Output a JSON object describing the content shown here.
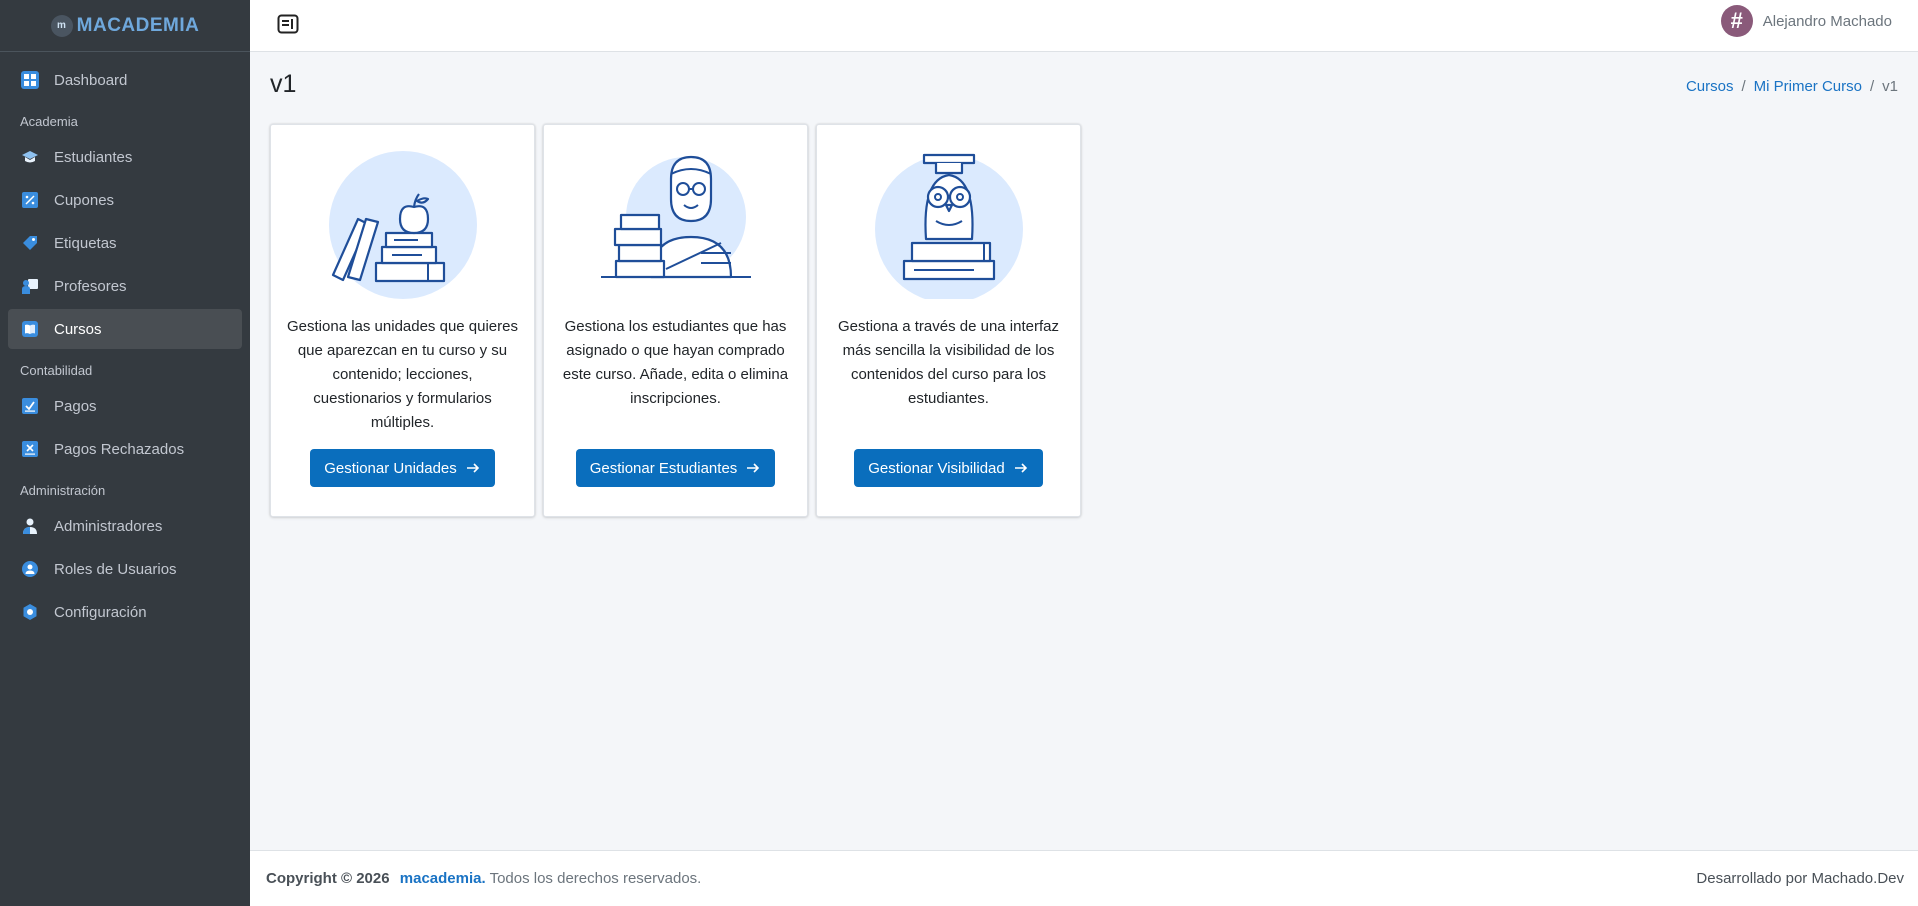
{
  "brand": {
    "name": "MACADEMIA",
    "mark_text": "m"
  },
  "sidebar": {
    "items": [
      {
        "label": "Dashboard",
        "icon": "dashboard-icon"
      },
      {
        "header": "Academia"
      },
      {
        "label": "Estudiantes",
        "icon": "graduation-cap-icon"
      },
      {
        "label": "Cupones",
        "icon": "coupon-icon"
      },
      {
        "label": "Etiquetas",
        "icon": "tag-icon"
      },
      {
        "label": "Profesores",
        "icon": "teacher-icon"
      },
      {
        "label": "Cursos",
        "icon": "book-open-icon",
        "active": true
      },
      {
        "header": "Contabilidad"
      },
      {
        "label": "Pagos",
        "icon": "payment-check-icon"
      },
      {
        "label": "Pagos Rechazados",
        "icon": "payment-rejected-icon"
      },
      {
        "header": "Administración"
      },
      {
        "label": "Administradores",
        "icon": "user-icon"
      },
      {
        "label": "Roles de Usuarios",
        "icon": "user-role-icon"
      },
      {
        "label": "Configuración",
        "icon": "settings-icon"
      }
    ]
  },
  "topbar": {
    "user_name": "Alejandro Machado",
    "avatar_symbol": "#"
  },
  "page": {
    "title": "v1",
    "breadcrumb": [
      "Cursos",
      "Mi Primer Curso",
      "v1"
    ]
  },
  "cards": [
    {
      "illustration": "books-apple-illustration",
      "text": "Gestiona las unidades que quieres que aparezcan en tu curso y su contenido; lecciones, cuestionarios y formularios múltiples.",
      "button": "Gestionar Unidades"
    },
    {
      "illustration": "student-books-illustration",
      "text": "Gestiona los estudiantes que has asignado o que hayan comprado este curso. Añade, edita o elimina inscripciones.",
      "button": "Gestionar Estudiantes"
    },
    {
      "illustration": "owl-books-illustration",
      "text": "Gestiona a través de una interfaz más sencilla la visibilidad de los contenidos del curso para los estudiantes.",
      "button": "Gestionar Visibilidad"
    }
  ],
  "footer": {
    "copyright": "Copyright © 2026",
    "brand": "macademia.",
    "rights": "Todos los derechos reservados.",
    "developer": "Desarrollado por Machado.Dev"
  },
  "colors": {
    "primary": "#0a6ebd",
    "sidebar_bg": "#343a40",
    "content_bg": "#f4f6f9",
    "illustration_bg": "#dbeafe",
    "illustration_stroke": "#1f4e99"
  }
}
